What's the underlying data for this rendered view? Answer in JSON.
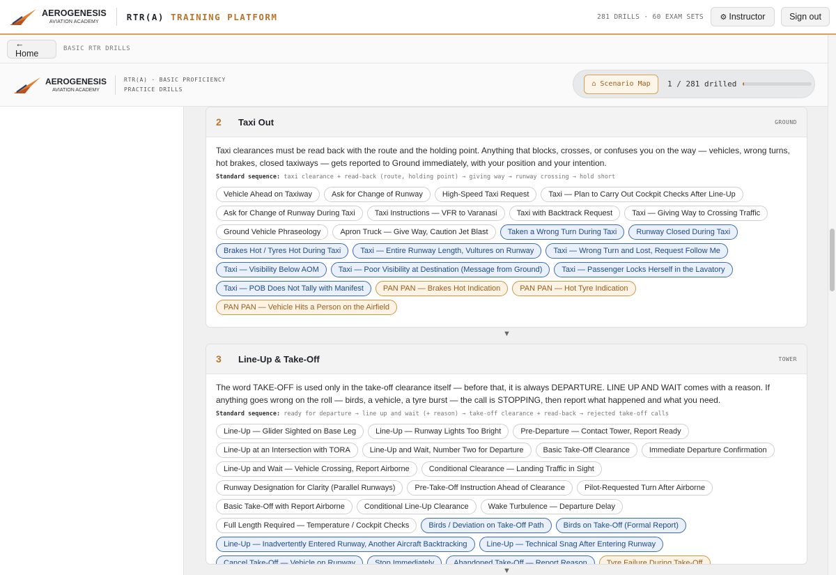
{
  "header": {
    "logo_name": "AEROGENESIS",
    "logo_sub": "AVIATION ACADEMY",
    "title_part1": "RTR(A) ",
    "title_part2": "TRAINING PLATFORM",
    "counts": "281 DRILLS · 60 EXAM SETS",
    "instructor_label": "Instructor",
    "signout_label": "Sign out"
  },
  "subbar": {
    "home_label": "← Home",
    "breadcrumb": "BASIC RTR DRILLS"
  },
  "brand": {
    "logo_name": "AEROGENESIS",
    "logo_sub": "AVIATION ACADEMY",
    "sub_line1": "RTR(A) · BASIC PROFICIENCY",
    "sub_line2": "PRACTICE DRILLS",
    "scenario_map_label": "⌂ Scenario Map",
    "drilled_text": "1 / 281 drilled",
    "progress_fraction": 0.0036
  },
  "colors": {
    "accent": "#b8742a",
    "chip_blue": "#3d6cb0",
    "chip_amber": "#d59442"
  },
  "sections": [
    {
      "num": "2",
      "title": "Taxi Out",
      "tag": "GROUND",
      "desc": "Taxi clearances must be read back with the route and the holding point. Anything that blocks, crosses, or confuses you on the way — vehicles, wrong turns, hot brakes, closed taxiways — gets reported to Ground immediately, with your position and your intention.",
      "seq_label": "Standard sequence:",
      "seq": "taxi clearance + read-back (route, holding point) → giving way → runway crossing → hold short",
      "chips": [
        {
          "label": "Vehicle Ahead on Taxiway",
          "state": "default"
        },
        {
          "label": "Ask for Change of Runway",
          "state": "default"
        },
        {
          "label": "High-Speed Taxi Request",
          "state": "default"
        },
        {
          "label": "Taxi — Plan to Carry Out Cockpit Checks After Line-Up",
          "state": "default"
        },
        {
          "label": "Ask for Change of Runway During Taxi",
          "state": "default"
        },
        {
          "label": "Taxi Instructions — VFR to Varanasi",
          "state": "default"
        },
        {
          "label": "Taxi with Backtrack Request",
          "state": "default"
        },
        {
          "label": "Taxi — Giving Way to Crossing Traffic",
          "state": "default"
        },
        {
          "label": "Ground Vehicle Phraseology",
          "state": "default"
        },
        {
          "label": "Apron Truck — Give Way, Caution Jet Blast",
          "state": "default"
        },
        {
          "label": "Taken a Wrong Turn During Taxi",
          "state": "blue"
        },
        {
          "label": "Runway Closed During Taxi",
          "state": "blue"
        },
        {
          "label": "Brakes Hot / Tyres Hot During Taxi",
          "state": "blue"
        },
        {
          "label": "Taxi — Entire Runway Length, Vultures on Runway",
          "state": "blue"
        },
        {
          "label": "Taxi — Wrong Turn and Lost, Request Follow Me",
          "state": "blue"
        },
        {
          "label": "Taxi — Visibility Below AOM",
          "state": "blue"
        },
        {
          "label": "Taxi — Poor Visibility at Destination (Message from Ground)",
          "state": "blue"
        },
        {
          "label": "Taxi — Passenger Locks Herself in the Lavatory",
          "state": "blue"
        },
        {
          "label": "Taxi — POB Does Not Tally with Manifest",
          "state": "blue"
        },
        {
          "label": "PAN PAN — Brakes Hot Indication",
          "state": "amber"
        },
        {
          "label": "PAN PAN — Hot Tyre Indication",
          "state": "amber"
        },
        {
          "label": "PAN PAN — Vehicle Hits a Person on the Airfield",
          "state": "amber"
        }
      ]
    },
    {
      "num": "3",
      "title": "Line-Up & Take-Off",
      "tag": "TOWER",
      "desc": "The word TAKE-OFF is used only in the take-off clearance itself — before that, it is always DEPARTURE. LINE UP AND WAIT comes with a reason. If anything goes wrong on the roll — birds, a vehicle, a tyre burst — the call is STOPPING, then report what happened and what you need.",
      "seq_label": "Standard sequence:",
      "seq": "ready for departure → line up and wait (+ reason) → take-off clearance + read-back → rejected take-off calls",
      "chips": [
        {
          "label": "Line-Up — Glider Sighted on Base Leg",
          "state": "default"
        },
        {
          "label": "Line-Up — Runway Lights Too Bright",
          "state": "default"
        },
        {
          "label": "Pre-Departure — Contact Tower, Report Ready",
          "state": "default"
        },
        {
          "label": "Line-Up at an Intersection with TORA",
          "state": "default"
        },
        {
          "label": "Line-Up and Wait, Number Two for Departure",
          "state": "default"
        },
        {
          "label": "Basic Take-Off Clearance",
          "state": "default"
        },
        {
          "label": "Immediate Departure Confirmation",
          "state": "default"
        },
        {
          "label": "Line-Up and Wait — Vehicle Crossing, Report Airborne",
          "state": "default"
        },
        {
          "label": "Conditional Clearance — Landing Traffic in Sight",
          "state": "default"
        },
        {
          "label": "Runway Designation for Clarity (Parallel Runways)",
          "state": "default"
        },
        {
          "label": "Pre-Take-Off Instruction Ahead of Clearance",
          "state": "default"
        },
        {
          "label": "Pilot-Requested Turn After Airborne",
          "state": "default"
        },
        {
          "label": "Basic Take-Off with Report Airborne",
          "state": "default"
        },
        {
          "label": "Conditional Line-Up Clearance",
          "state": "default"
        },
        {
          "label": "Wake Turbulence — Departure Delay",
          "state": "default"
        },
        {
          "label": "Full Length Required — Temperature / Cockpit Checks",
          "state": "default"
        },
        {
          "label": "Birds / Deviation on Take-Off Path",
          "state": "blue"
        },
        {
          "label": "Birds on Take-Off (Formal Report)",
          "state": "blue"
        },
        {
          "label": "Line-Up — Inadvertently Entered Runway, Another Aircraft Backtracking",
          "state": "blue"
        },
        {
          "label": "Line-Up — Technical Snag After Entering Runway",
          "state": "blue"
        },
        {
          "label": "Cancel Take-Off — Vehicle on Runway",
          "state": "blue"
        },
        {
          "label": "Stop Immediately",
          "state": "blue"
        },
        {
          "label": "Abandoned Take-Off — Report Reason",
          "state": "blue"
        },
        {
          "label": "Tyre Failure During Take-Off",
          "state": "amber"
        }
      ]
    }
  ],
  "connector_glyph": "▼"
}
